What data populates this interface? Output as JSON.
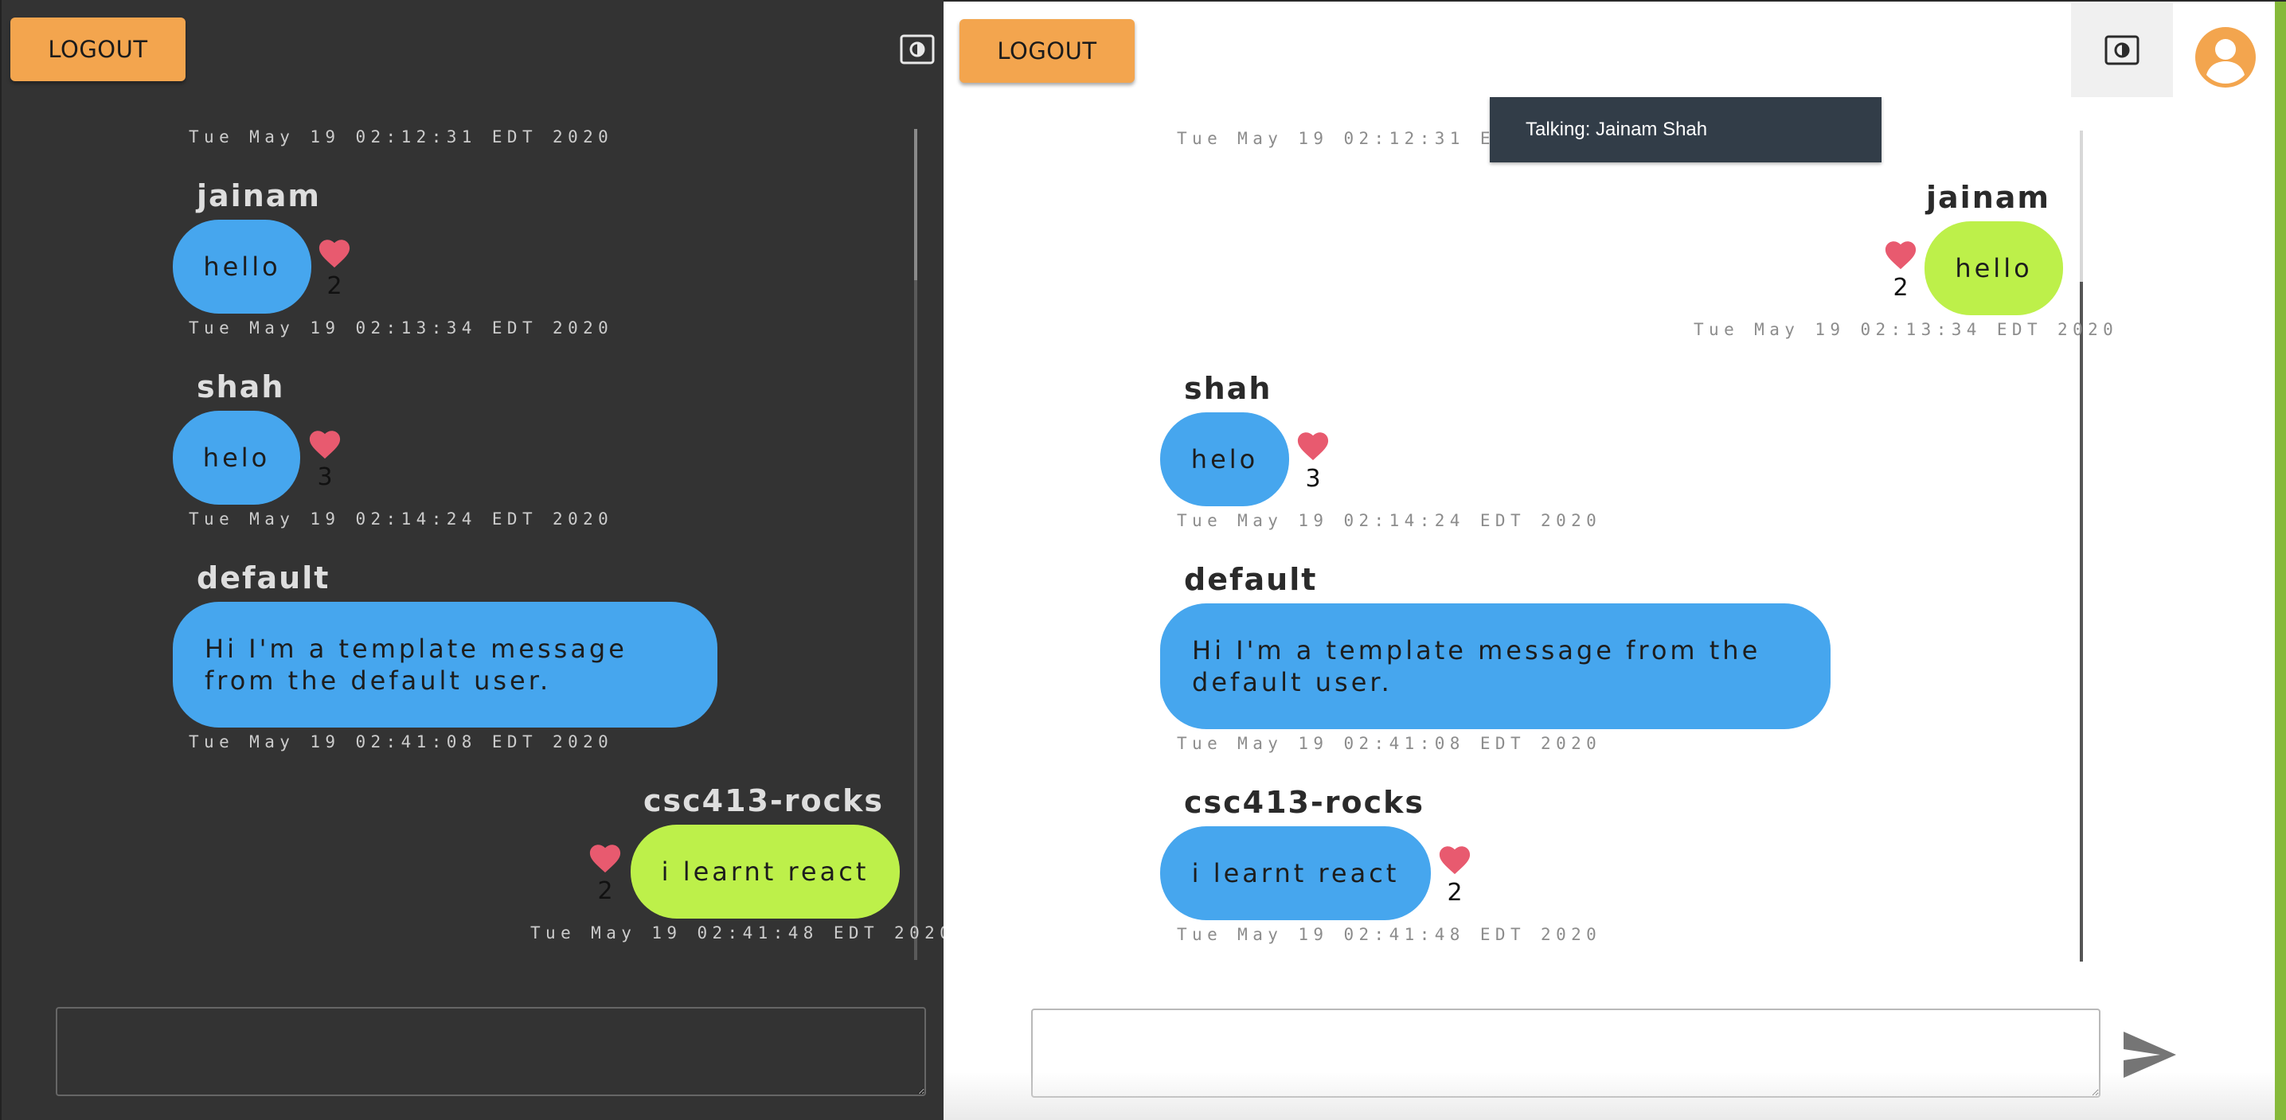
{
  "colors": {
    "dark_bg": "#333333",
    "light_bg": "#ffffff",
    "logout_orange": "#f3a54e",
    "other_bubble_blue": "#46a6ee",
    "own_bubble_green": "#bdf04a",
    "heart_red": "#e85a6f",
    "accent_green": "#86b93a"
  },
  "left_panel": {
    "logout_label": "LOGOUT",
    "theme_toggle_icon": "brightness-icon",
    "top_timestamp": "Tue May 19 02:12:31 EDT 2020",
    "messages": [
      {
        "user": "jainam",
        "text": "hello",
        "likes": "2",
        "timestamp": "Tue May 19 02:13:34 EDT 2020"
      },
      {
        "user": "shah",
        "text": "helo",
        "likes": "3",
        "timestamp": "Tue May 19 02:14:24 EDT 2020"
      },
      {
        "user": "default",
        "text": "Hi I'm a template message from the default user.",
        "timestamp": "Tue May 19 02:41:08 EDT 2020"
      },
      {
        "user": "csc413-rocks",
        "text": "i learnt react",
        "likes": "2",
        "timestamp": "Tue May 19 02:41:48 EDT 2020"
      }
    ],
    "input_value": ""
  },
  "right_panel": {
    "logout_label": "LOGOUT",
    "theme_toggle_icon": "brightness-icon",
    "avatar_icon": "account-circle-icon",
    "tooltip": "Talking: Jainam Shah",
    "top_timestamp": "Tue May 19 02:12:31 EDT 2020",
    "messages": [
      {
        "user": "jainam",
        "text": "hello",
        "likes": "2",
        "timestamp": "Tue May 19 02:13:34 EDT 2020"
      },
      {
        "user": "shah",
        "text": "helo",
        "likes": "3",
        "timestamp": "Tue May 19 02:14:24 EDT 2020"
      },
      {
        "user": "default",
        "text": "Hi I'm a template message from the default user.",
        "timestamp": "Tue May 19 02:41:08 EDT 2020"
      },
      {
        "user": "csc413-rocks",
        "text": "i learnt react",
        "likes": "2",
        "timestamp": "Tue May 19 02:41:48 EDT 2020"
      }
    ],
    "input_value": "",
    "send_icon": "send-icon"
  }
}
